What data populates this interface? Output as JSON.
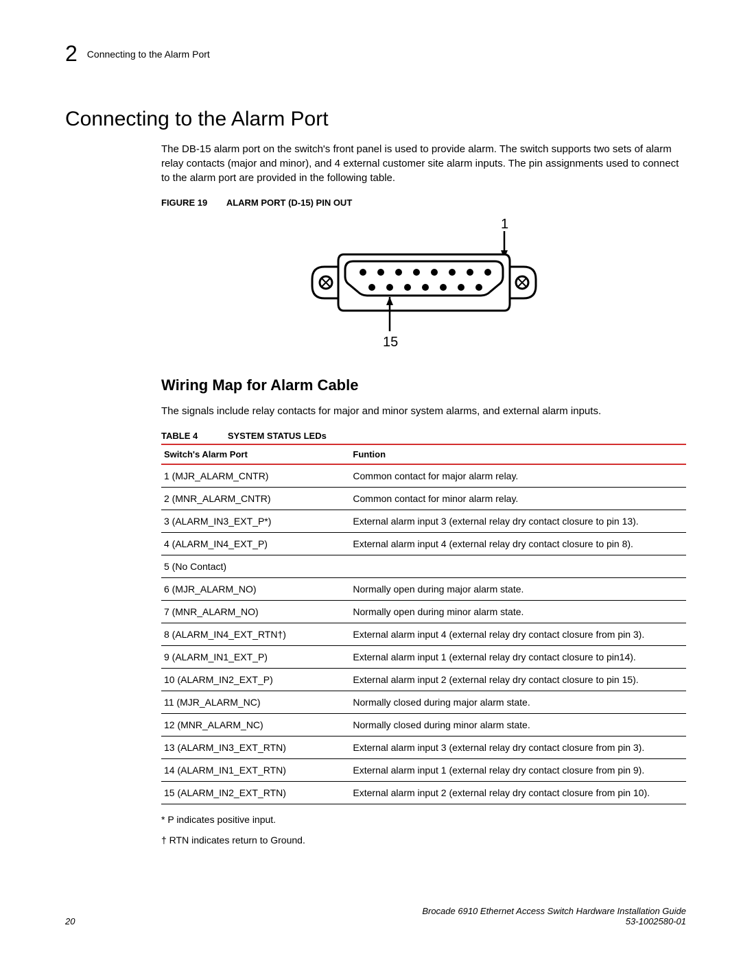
{
  "header": {
    "chapter_number": "2",
    "running_head": "Connecting to the Alarm Port"
  },
  "section": {
    "title": "Connecting to the Alarm Port",
    "intro": "The DB-15 alarm port on the switch's front panel is used to provide alarm. The switch supports two sets of alarm relay contacts (major and minor), and 4 external customer site alarm inputs. The pin assignments used to connect to the alarm port are provided in the following table."
  },
  "figure": {
    "label": "FIGURE 19",
    "title": "ALARM PORT (D-15) PIN OUT",
    "pin_label_top": "1",
    "pin_label_bottom": "15"
  },
  "subsection": {
    "title": "Wiring Map for Alarm Cable",
    "intro": "The signals include relay contacts for major and minor system alarms, and external alarm inputs."
  },
  "table": {
    "label": "TABLE 4",
    "title": "SYSTEM STATUS LEDs",
    "headers": {
      "col1": "Switch's Alarm Port",
      "col2": "Funtion"
    },
    "rows": [
      {
        "port": "1 (MJR_ALARM_CNTR)",
        "func": "Common contact for major alarm relay."
      },
      {
        "port": "2 (MNR_ALARM_CNTR)",
        "func": "Common contact for minor alarm relay."
      },
      {
        "port": "3 (ALARM_IN3_EXT_P*)",
        "func": "External alarm input 3 (external relay dry contact closure to pin 13)."
      },
      {
        "port": "4 (ALARM_IN4_EXT_P)",
        "func": "External alarm input 4 (external relay dry contact closure to pin 8)."
      },
      {
        "port": "5 (No Contact)",
        "func": ""
      },
      {
        "port": "6 (MJR_ALARM_NO)",
        "func": "Normally open during major alarm state."
      },
      {
        "port": "7 (MNR_ALARM_NO)",
        "func": "Normally open during minor alarm state."
      },
      {
        "port": "8 (ALARM_IN4_EXT_RTN†)",
        "func": "External alarm input 4 (external relay dry contact closure from pin 3)."
      },
      {
        "port": "9 (ALARM_IN1_EXT_P)",
        "func": "External alarm input 1 (external relay dry contact closure to pin14)."
      },
      {
        "port": "10 (ALARM_IN2_EXT_P)",
        "func": "External alarm input 2 (external relay dry contact closure to pin 15)."
      },
      {
        "port": "11 (MJR_ALARM_NC)",
        "func": "Normally closed during major alarm state."
      },
      {
        "port": "12 (MNR_ALARM_NC)",
        "func": "Normally closed during minor alarm state."
      },
      {
        "port": "13 (ALARM_IN3_EXT_RTN)",
        "func": "External alarm input 3 (external relay dry contact closure from pin 3)."
      },
      {
        "port": "14 (ALARM_IN1_EXT_RTN)",
        "func": "External alarm input 1 (external relay dry contact closure from pin 9)."
      },
      {
        "port": "15 (ALARM_IN2_EXT_RTN)",
        "func": "External alarm input 2 (external relay dry contact closure from pin 10)."
      }
    ]
  },
  "notes": {
    "note1": "* P indicates positive input.",
    "note2": "† RTN indicates return to Ground."
  },
  "footer": {
    "page_num": "20",
    "doc_title": "Brocade 6910 Ethernet Access Switch Hardware Installation Guide",
    "doc_id": "53-1002580-01"
  }
}
